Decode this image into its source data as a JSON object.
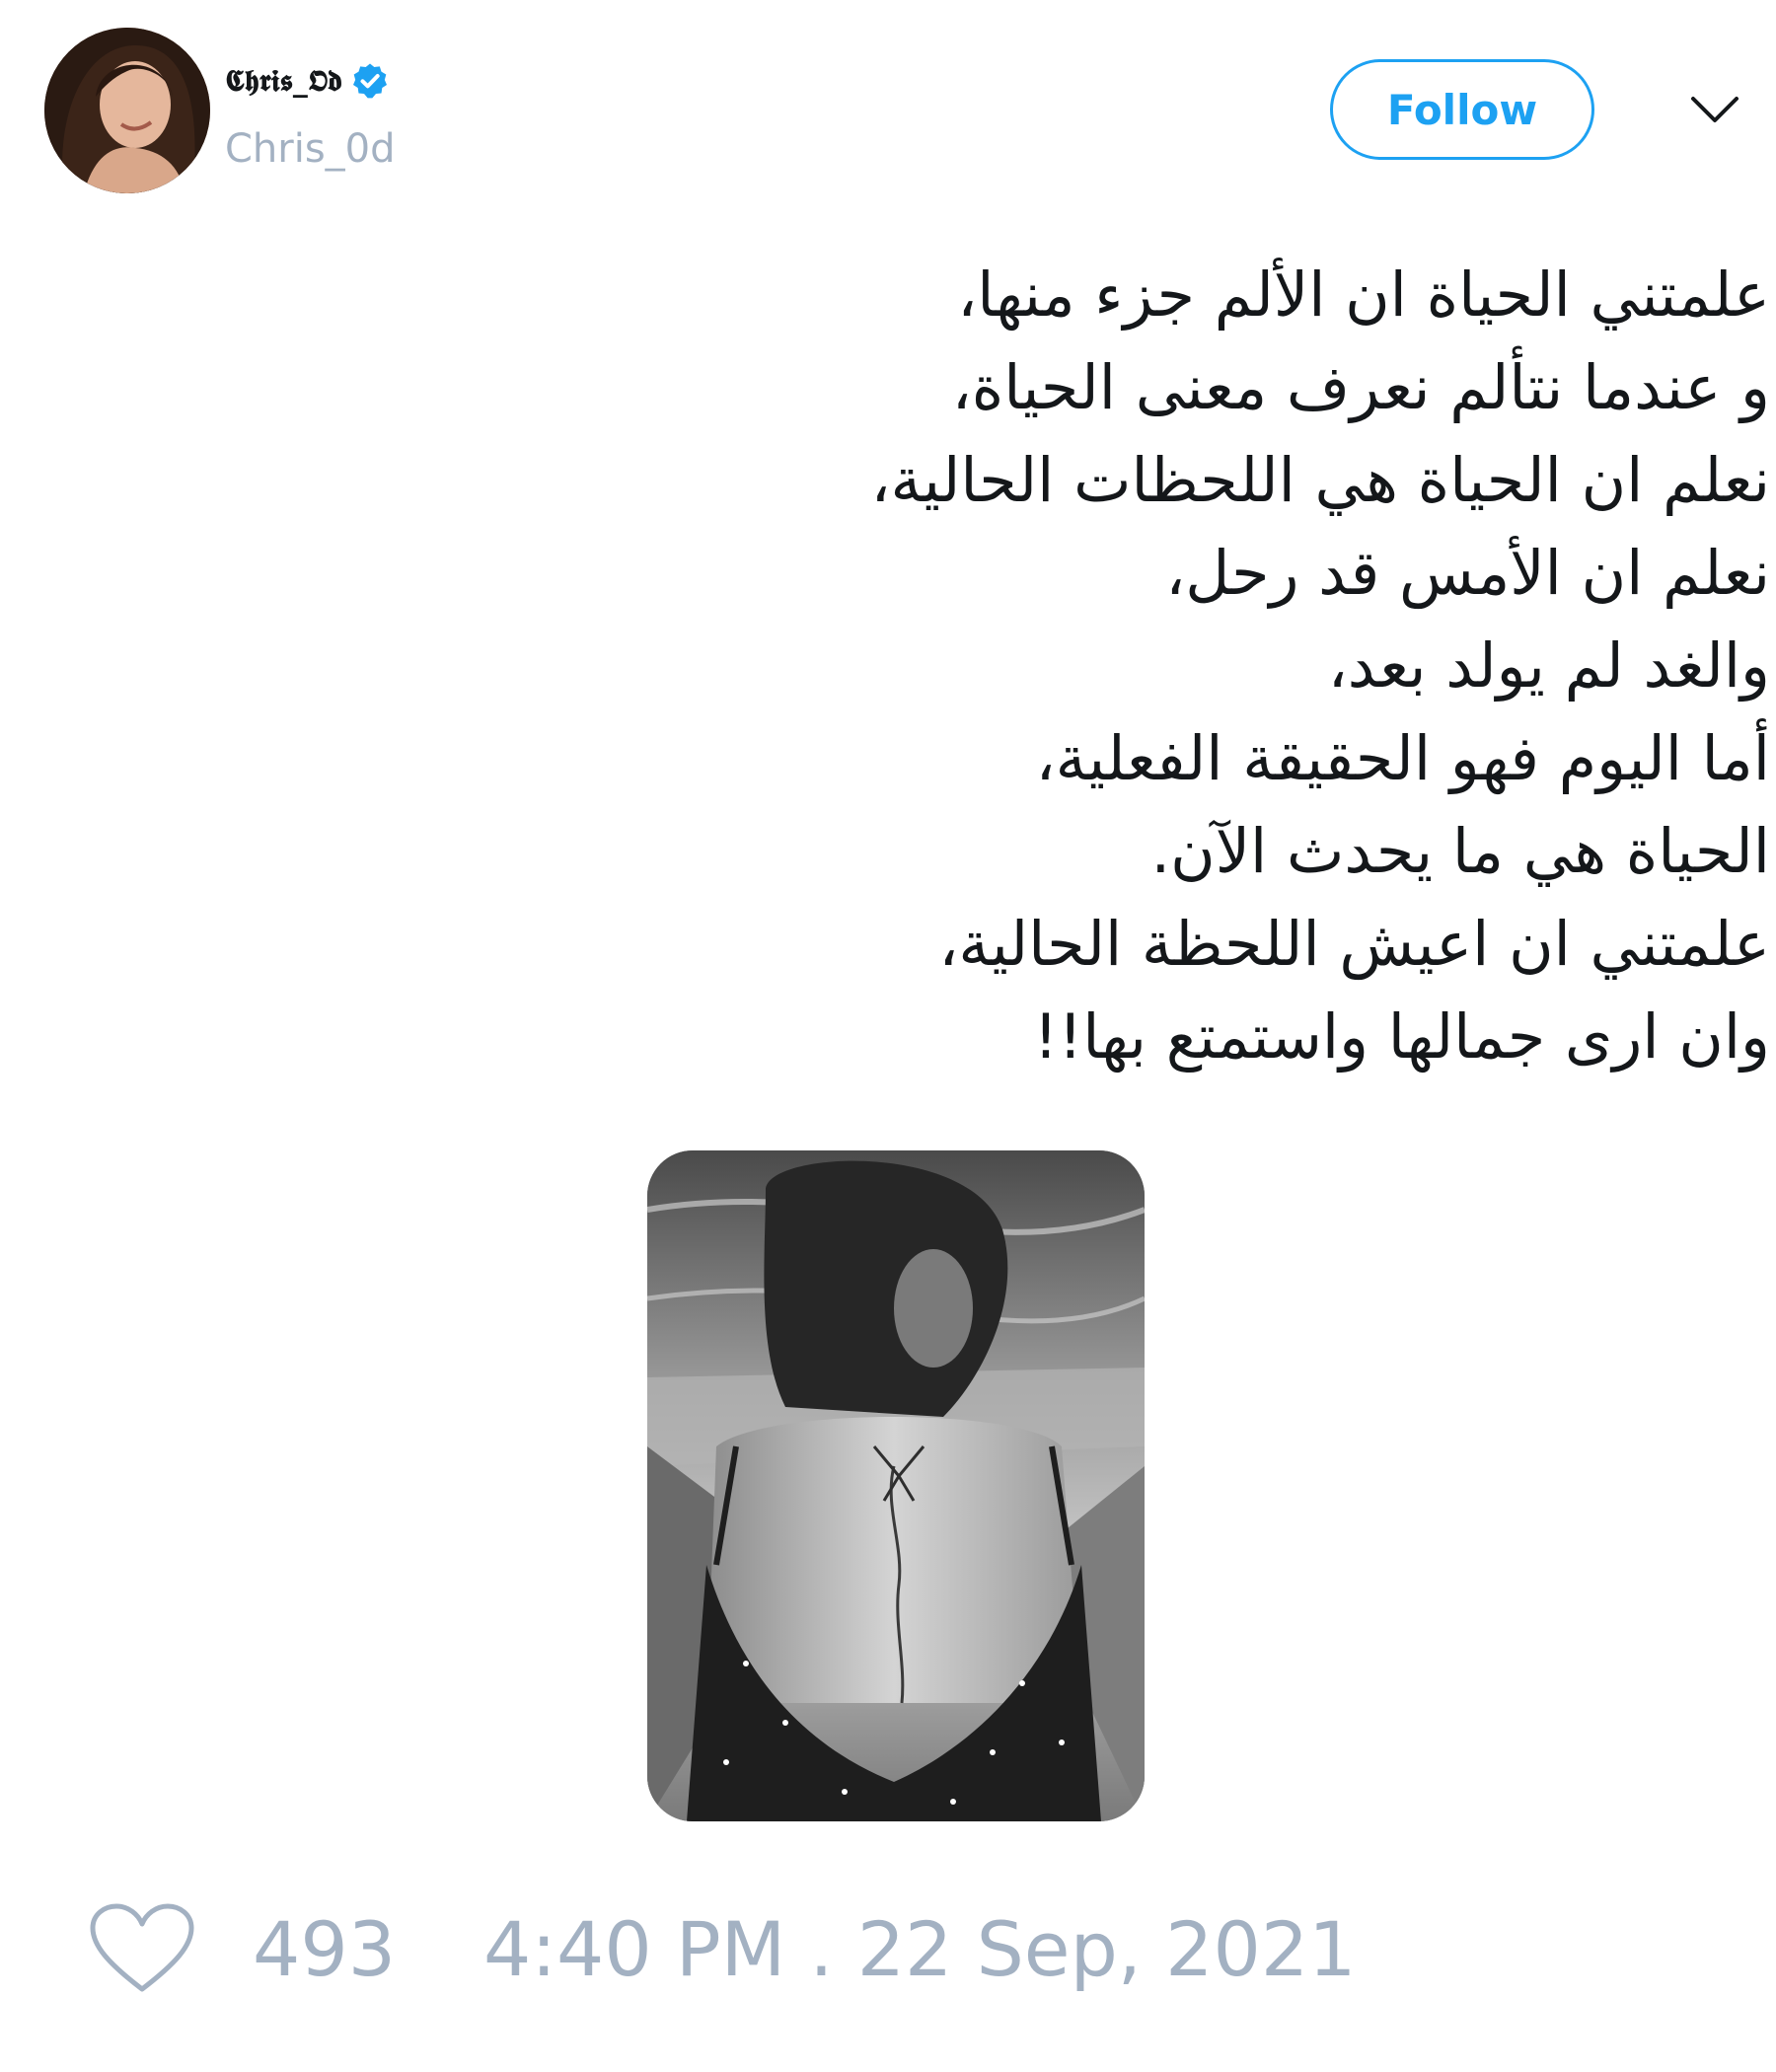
{
  "author": {
    "display_name": "𝕮𝖍𝖗𝖎𝖘_𝕺𝖉",
    "handle": "Chris_0d",
    "verified": true,
    "avatar_icon": "profile-photo"
  },
  "header": {
    "follow_label": "Follow",
    "menu_icon": "chevron-down-icon"
  },
  "tweet": {
    "lines": [
      "علمتني الحياة ان الألم جزء منها،",
      "و عندما نتألم نعرف معنى الحياة،",
      "نعلم ان الحياة هي اللحظات الحالية،",
      "نعلم ان الأمس قد رحل،",
      "والغد لم يولد بعد،",
      "أما اليوم فهو الحقيقة الفعلية،",
      "الحياة هي ما يحدث الآن.",
      "علمتني ان اعيش اللحظة الحالية،",
      "وان ارى جمالها واستمتع بها!!"
    ],
    "media_icon": "photo"
  },
  "footer": {
    "like_icon": "heart-icon",
    "like_count": "493",
    "timestamp": "4:40 PM . 22 Sep, 2021"
  },
  "colors": {
    "accent": "#1da1f2",
    "muted": "#a3b1c2",
    "text": "#14171a"
  }
}
